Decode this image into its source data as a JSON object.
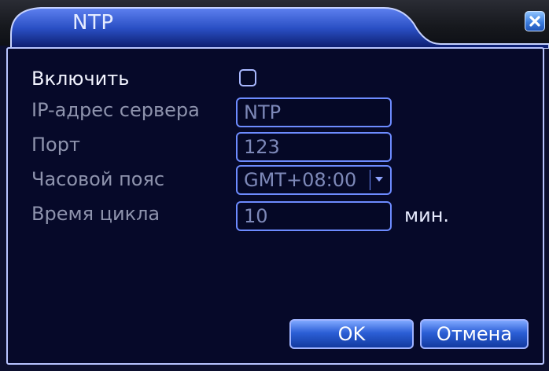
{
  "window": {
    "title": "NTP"
  },
  "form": {
    "enable_label": "Включить",
    "enable_checked": false,
    "server_label": "IP-адрес сервера",
    "server_value": "NTP",
    "port_label": "Порт",
    "port_value": "123",
    "timezone_label": "Часовой пояс",
    "timezone_value": "GMT+08:00",
    "cycle_label": "Время цикла",
    "cycle_value": "10",
    "cycle_unit": "мин."
  },
  "buttons": {
    "ok_label": "OK",
    "cancel_label": "Отмена"
  },
  "icons": {
    "close": "close-icon",
    "dropdown": "chevron-down-icon"
  },
  "colors": {
    "background": "#060929",
    "field_border": "#6d8bff",
    "button_blue": "#2c5fd6",
    "close_blue": "#3d7fe0"
  }
}
